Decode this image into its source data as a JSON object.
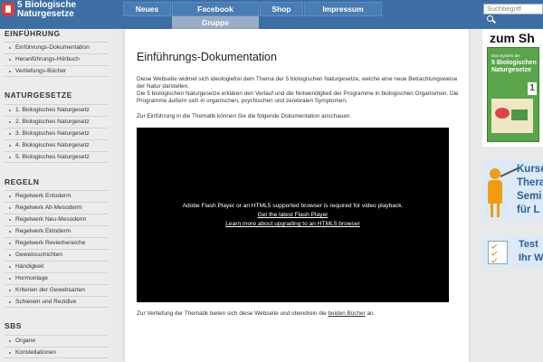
{
  "header": {
    "logo_line1": "5 Biologische",
    "logo_line2": "Naturgesetze",
    "nav": [
      {
        "label": "Neues"
      },
      {
        "label": "Facebook"
      },
      {
        "label": "Shop"
      },
      {
        "label": "Impressum"
      }
    ],
    "nav_sub": "Gruppe",
    "search_placeholder": "Suchbegriff"
  },
  "sidebar": {
    "sections": [
      {
        "heading": "EINFÜHRUNG",
        "items": [
          "Einführungs-Dokumentation",
          "Heranführungs-Hörbuch",
          "Vertiefungs-Bücher"
        ]
      },
      {
        "heading": "NATURGESETZE",
        "items": [
          "1. Biologisches Naturgesetz",
          "2. Biologisches Naturgesetz",
          "3. Biologisches Naturgesetz",
          "4. Biologisches Naturgesetz",
          "5. Biologisches Naturgesetz"
        ]
      },
      {
        "heading": "REGELN",
        "items": [
          "Regelwerk Entoderm",
          "Regelwerk Alt-Mesoderm",
          "Regelwerk Neu-Mesoderm",
          "Regelwerk Ektoderm",
          "Regelwerk Revierbereiche",
          "Gewebsschichten",
          "Händigkeit",
          "Hormonlage",
          "Kriterien der Gewebsarten",
          "Schienen und Rezidive"
        ]
      },
      {
        "heading": "SBS",
        "items": [
          "Organe",
          "Konstellationen"
        ]
      }
    ]
  },
  "main": {
    "title": "Einführungs-Dokumentation",
    "para1": "Diese Webseite widmet sich ideologiefrei dem Thema der 5 biologischen Naturgesetze, welche eine neue Betrachtungsweise der Natur darstellen.",
    "para2": "Die 5 biologischen Naturgesetze erklären den Verlauf und die Notwendigkeit der Programme in biologischen Organismen. Die Programme äußern sich in organischen, psychischen und zerebralen Symptomen.",
    "para3": "Zur Einführung in die Thematik können Sie die folgende Dokumentation anschauen.",
    "video": {
      "message": "Adobe Flash Player or an HTML5 supported browser is required for video playback.",
      "link1": "Get the latest Flash Player",
      "link2": "Learn more about upgrading to an HTML5 browser"
    },
    "footer_text": "Zur Vertiefung der Thematik bieten sich diese Webseite und obendrein die ",
    "footer_link": "beiden Bücher",
    "footer_suffix": " an."
  },
  "ads": {
    "ad1_title": "zum Sh",
    "book_small": "Das System der",
    "book_title": "5 Biologischen Naturgesetze",
    "book_badge": "1",
    "ad2_lines": [
      "Kurse",
      "Thera",
      "Semi",
      "für L"
    ],
    "ad3_lines": [
      "Test",
      "Ihr W"
    ]
  }
}
